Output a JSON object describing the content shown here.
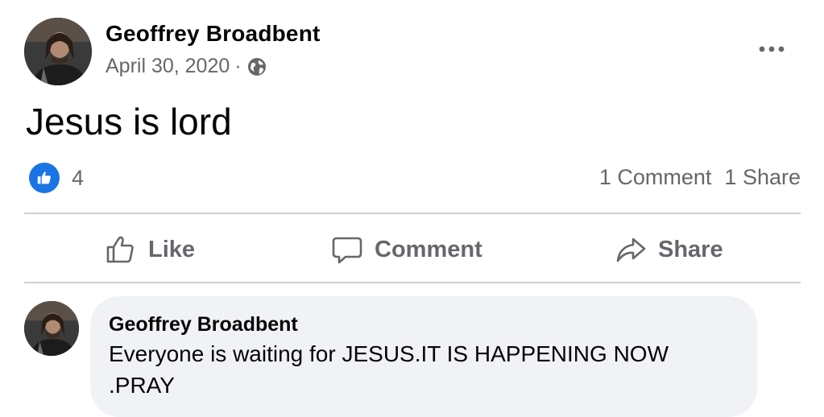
{
  "post": {
    "author": "Geoffrey Broadbent",
    "date": "April 30, 2020",
    "separator": "·",
    "privacy_icon": "globe-icon",
    "text": "Jesus is lord",
    "reactions": {
      "icon": "like-icon",
      "count": "4"
    },
    "comments_count": "1 Comment",
    "shares_count": "1 Share"
  },
  "actions": {
    "like": "Like",
    "comment": "Comment",
    "share": "Share"
  },
  "comment": {
    "author": "Geoffrey Broadbent",
    "text": "Everyone is waiting for JESUS.IT IS HAPPENING NOW .PRAY"
  },
  "colors": {
    "accent_blue": "#1b74e4",
    "secondary_text": "#65676b",
    "comment_bg": "#f0f2f5",
    "divider": "#ced0d4"
  }
}
